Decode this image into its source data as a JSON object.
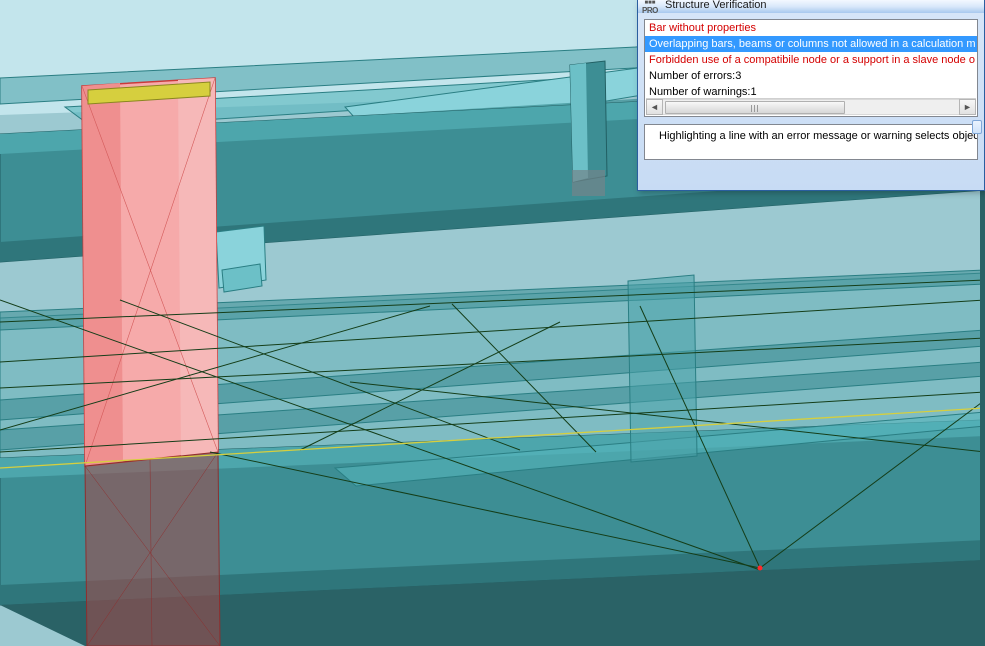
{
  "dialog": {
    "title": "Structure Verification",
    "badge_top": "■■■",
    "badge_bottom": "PRO",
    "messages": {
      "m0": "Bar without properties",
      "m1": "Overlapping bars, beams or columns not allowed in a calculation m",
      "m2": "Forbidden use of a compatibile node or a support in a slave node o",
      "m3": "Number of errors:3",
      "m4": "Number of warnings:1"
    },
    "hint": "Highlighting a line with an error message or warning selects objec",
    "scroll_left": "◄",
    "scroll_right": "►"
  }
}
